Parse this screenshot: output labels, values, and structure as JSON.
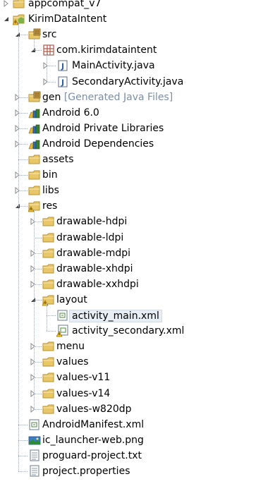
{
  "tree": [
    {
      "level": 0,
      "label": "appcompat_v7",
      "icon": "project-folder-icon",
      "toggle": "collapsed",
      "partial": true
    },
    {
      "level": 0,
      "label": "KirimDataIntent",
      "icon": "android-project-icon",
      "toggle": "expanded"
    },
    {
      "level": 1,
      "label": "src",
      "icon": "source-folder-icon",
      "toggle": "expanded"
    },
    {
      "level": 2,
      "label": "com.kirimdataintent",
      "icon": "package-icon",
      "toggle": "expanded"
    },
    {
      "level": 3,
      "label": "MainActivity.java",
      "icon": "java-file-icon",
      "toggle": "collapsed"
    },
    {
      "level": 3,
      "label": "SecondaryActivity.java",
      "icon": "java-file-icon",
      "toggle": "collapsed"
    },
    {
      "level": 1,
      "label": "gen",
      "decoration": "[Generated Java Files]",
      "icon": "source-folder-icon",
      "toggle": "collapsed"
    },
    {
      "level": 1,
      "label": "Android 6.0",
      "icon": "library-icon",
      "toggle": "collapsed"
    },
    {
      "level": 1,
      "label": "Android Private Libraries",
      "icon": "library-icon",
      "toggle": "collapsed"
    },
    {
      "level": 1,
      "label": "Android Dependencies",
      "icon": "library-icon",
      "toggle": "collapsed"
    },
    {
      "level": 1,
      "label": "assets",
      "icon": "folder-icon",
      "toggle": "none"
    },
    {
      "level": 1,
      "label": "bin",
      "icon": "folder-icon",
      "toggle": "collapsed"
    },
    {
      "level": 1,
      "label": "libs",
      "icon": "folder-icon",
      "toggle": "collapsed"
    },
    {
      "level": 1,
      "label": "res",
      "icon": "warning-folder-icon",
      "toggle": "expanded"
    },
    {
      "level": 2,
      "label": "drawable-hdpi",
      "icon": "folder-icon",
      "toggle": "collapsed"
    },
    {
      "level": 2,
      "label": "drawable-ldpi",
      "icon": "folder-icon",
      "toggle": "none"
    },
    {
      "level": 2,
      "label": "drawable-mdpi",
      "icon": "folder-icon",
      "toggle": "collapsed"
    },
    {
      "level": 2,
      "label": "drawable-xhdpi",
      "icon": "folder-icon",
      "toggle": "collapsed"
    },
    {
      "level": 2,
      "label": "drawable-xxhdpi",
      "icon": "folder-icon",
      "toggle": "collapsed"
    },
    {
      "level": 2,
      "label": "layout",
      "icon": "warning-folder-icon",
      "toggle": "expanded"
    },
    {
      "level": 3,
      "label": "activity_main.xml",
      "icon": "xml-file-icon",
      "toggle": "none",
      "selected": true
    },
    {
      "level": 3,
      "label": "activity_secondary.xml",
      "icon": "xml-warning-file-icon",
      "toggle": "none"
    },
    {
      "level": 2,
      "label": "menu",
      "icon": "folder-icon",
      "toggle": "collapsed"
    },
    {
      "level": 2,
      "label": "values",
      "icon": "folder-icon",
      "toggle": "collapsed"
    },
    {
      "level": 2,
      "label": "values-v11",
      "icon": "folder-icon",
      "toggle": "collapsed"
    },
    {
      "level": 2,
      "label": "values-v14",
      "icon": "folder-icon",
      "toggle": "collapsed"
    },
    {
      "level": 2,
      "label": "values-w820dp",
      "icon": "folder-icon",
      "toggle": "collapsed"
    },
    {
      "level": 1,
      "label": "AndroidManifest.xml",
      "icon": "xml-file-icon",
      "toggle": "none"
    },
    {
      "level": 1,
      "label": "ic_launcher-web.png",
      "icon": "image-file-icon",
      "toggle": "none"
    },
    {
      "level": 1,
      "label": "proguard-project.txt",
      "icon": "text-file-icon",
      "toggle": "none"
    },
    {
      "level": 1,
      "label": "project.properties",
      "icon": "text-file-icon",
      "toggle": "none"
    }
  ],
  "colors": {
    "folder": "#e9c766",
    "folder_border": "#b8912e",
    "decoration": "#7a8fa8",
    "selection": "#e8eef6",
    "java_file": "#2f5fa8",
    "library": "#2b6cb0",
    "library_books": "#e5b43a",
    "package": "#b5564a",
    "warning": "#f2c230",
    "android_green": "#7cb342"
  }
}
